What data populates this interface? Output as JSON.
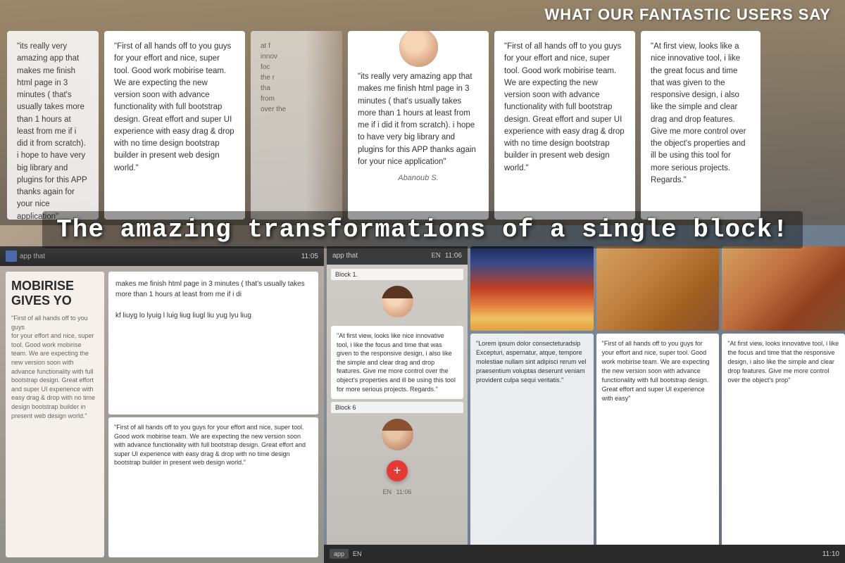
{
  "heading": {
    "title": "WHAT OUR FANTASTIC USERS SAY"
  },
  "overlay": {
    "text": "The amazing transformations of a single block!"
  },
  "testimonials": [
    {
      "id": "t1",
      "text": "\"its really very amazing app that makes me finish html page in 3 minutes ( that's usually takes more than 1 hours at least from me if i did it from scratch). i hope to have very big library and plugins for this APP thanks again for your nice application\"",
      "has_avatar": false,
      "reviewer": ""
    },
    {
      "id": "t2",
      "text": "\"First of all hands off to you guys for your effort and nice, super tool. Good work mobirise team. We are expecting the new version soon with advance functionality with full bootstrap design. Great effort and super UI experience with easy drag & drop with no time design bootstrap builder in present web design world.\"",
      "has_avatar": false,
      "reviewer": ""
    },
    {
      "id": "t3",
      "text": "\"its really very amazing app that makes me finish html page in 3 minutes ( that's usually takes more than 1 hours at least from me if i did it from scratch). i hope to have very big library and plugins for this APP thanks again for your nice application\"",
      "has_avatar": true,
      "reviewer": "Abanoub S."
    },
    {
      "id": "t4",
      "text": "\"First of all hands off to you guys for your effort and nice, super tool. Good work mobirise team. We are expecting the new version soon with advance functionality with full bootstrap design. Great effort and super UI experience with easy drag & drop with no time design bootstrap builder in present web design world.\"",
      "has_avatar": false,
      "reviewer": ""
    },
    {
      "id": "t5",
      "text": "\"At first view, looks like a nice innovative tool, i like the great focus and time that was given to the responsive design, i also like the simple and clear drag and drop features. Give me more control over the object's properties and ill be using this tool for more serious projects. Regards.\"",
      "has_avatar": false,
      "reviewer": ""
    }
  ],
  "editor": {
    "mobirise_heading": "MOBIRISE GIVES YO",
    "block1_label": "Block 1.",
    "block6_label": "Block 6",
    "time1": "11:05",
    "time2": "11:06",
    "time3": "11:10",
    "lang": "EN",
    "advance_functionality": "advance functionality",
    "object_properties": "the object $ properties"
  },
  "small_testimonials": [
    {
      "id": "st1",
      "text": "\"First of all hands off to you guys for your effort and nice, super tool. Good work mobirise team. We are expecting the new version soon with advance functionality with full bootstrap design. Great effort and super UI experience with easy drag & drop with no time design bootstrap builder in present web design world.\""
    },
    {
      "id": "st2",
      "text": "\"At first view, looks like nice innovative tool, i like the focus and time that was given to the responsive design, i also like the simple and clear drag and drop features. Give me more control over the object's properties and ill be using this tool for more serious projects. Regards.\""
    },
    {
      "id": "st3",
      "text": "\"First of all hands off to you guys for your effort and nice, super tool. Good work mobirise team. We are expecting the new version soon with advance functionality with full bootstrap design. Great effort and super UI experience with easy drag & drop\""
    },
    {
      "id": "st4",
      "text": "\"At first view, looks innovative tool, i like the focus and time that the responsive design, i also like the simple and clear drop features. Give me more control over the object's prop\""
    },
    {
      "id": "st5",
      "text": "\"First of all hands off to you guys for your effort and nice, super tool. Good work mobirise team. We are expecting the new version soon with advance functionality with full bootstrap design. Great effort and super UI experience with easy\""
    }
  ],
  "lorem": {
    "text": "\"Lorem ipsum dolor consecteturadsip Excepturi, aspernatur, atque, tempore molestiae nullam sint adipisci rerum vel praesentium voluptas deserunt veniam provident culpa sequi veritatis.\""
  },
  "editor_text": {
    "block_content": "makes me finish html page in 3 minutes ( that's usually takes more than 1 hours at least from me if i di",
    "random_text": "kf liuyg lo lyuig l luig  liug  liugl liu yug lyu liug"
  }
}
